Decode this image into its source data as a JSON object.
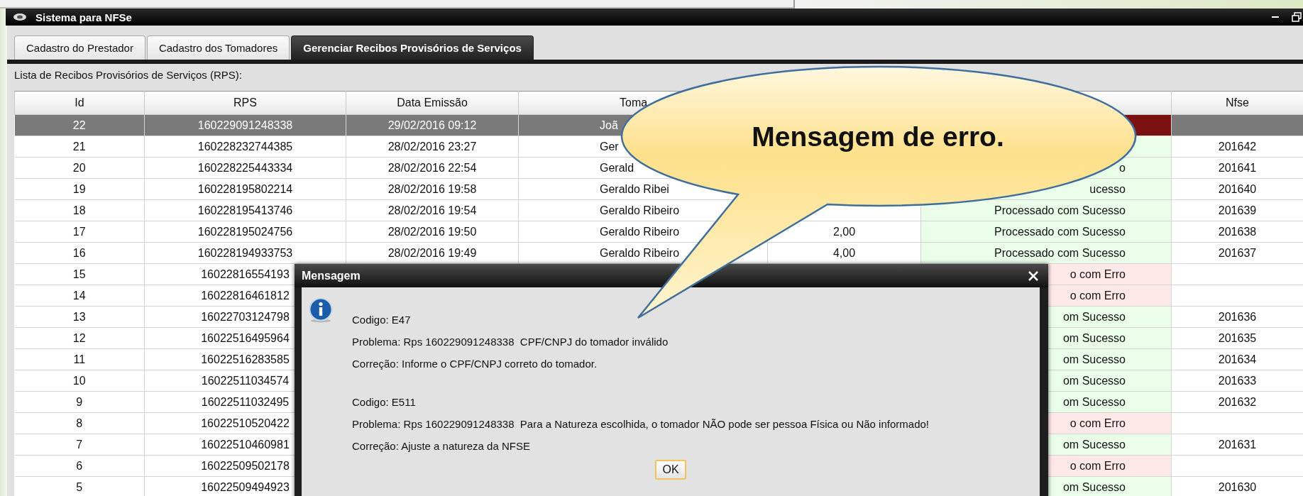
{
  "window": {
    "title": "Sistema para NFSe"
  },
  "tabs": [
    {
      "label": "Cadastro do Prestador",
      "selected": false
    },
    {
      "label": "Cadastro dos Tomadores",
      "selected": false
    },
    {
      "label": "Gerenciar Recibos Provisórios de Serviços",
      "selected": true
    }
  ],
  "list_label": "Lista de Recibos Provisórios de Serviços (RPS):",
  "table": {
    "columns": [
      {
        "label": "Id"
      },
      {
        "label": "RPS"
      },
      {
        "label": "Data Emissão"
      },
      {
        "label": "Toma"
      },
      {},
      {},
      {
        "label": "Nfse"
      }
    ],
    "rows": [
      {
        "id": "22",
        "rps": "160229091248338",
        "date": "29/02/2016 09:12",
        "tomador": "Joã",
        "failed": true,
        "selected": true
      },
      {
        "id": "21",
        "rps": "160228232744385",
        "date": "28/02/2016 23:27",
        "tomador": "Ger",
        "failed": false,
        "nfse": "201642",
        "selected": false
      },
      {
        "id": "20",
        "rps": "160228225443334",
        "date": "28/02/2016 22:54",
        "tomador": "Gerald",
        "status": "o",
        "failed": false,
        "nfse": "201641",
        "selected": false
      },
      {
        "id": "19",
        "rps": "160228195802214",
        "date": "28/02/2016 19:58",
        "tomador": "Geraldo Ribei",
        "status": "ucesso",
        "failed": false,
        "nfse": "201640",
        "selected": false
      },
      {
        "id": "18",
        "rps": "160228195413746",
        "date": "28/02/2016 19:54",
        "tomador": "Geraldo Ribeiro",
        "status": "Processado com Sucesso",
        "failed": false,
        "nfse": "201639",
        "selected": false
      },
      {
        "id": "17",
        "rps": "160228195024756",
        "date": "28/02/2016 19:50",
        "tomador": "Geraldo Ribeiro",
        "valor": "2,00",
        "status": "Processado com Sucesso",
        "failed": false,
        "nfse": "201638",
        "selected": false
      },
      {
        "id": "16",
        "rps": "160228194933753",
        "date": "28/02/2016 19:49",
        "tomador": "Geraldo Ribeiro",
        "valor": "4,00",
        "status": "Processado com Sucesso",
        "failed": false,
        "nfse": "201637",
        "selected": false
      },
      {
        "id": "15",
        "rps": "16022816554193",
        "status": "o com Erro",
        "failed": true,
        "selected": false
      },
      {
        "id": "14",
        "rps": "16022816461812",
        "status": "o com Erro",
        "failed": true,
        "selected": false
      },
      {
        "id": "13",
        "rps": "16022703124798",
        "status": "om Sucesso",
        "failed": false,
        "nfse": "201636",
        "selected": false
      },
      {
        "id": "12",
        "rps": "16022516495964",
        "status": "om Sucesso",
        "failed": false,
        "nfse": "201635",
        "selected": false
      },
      {
        "id": "11",
        "rps": "16022516283585",
        "status": "om Sucesso",
        "failed": false,
        "nfse": "201634",
        "selected": false
      },
      {
        "id": "10",
        "rps": "16022511034574",
        "status": "om Sucesso",
        "failed": false,
        "nfse": "201633",
        "selected": false
      },
      {
        "id": "9",
        "rps": "16022511032495",
        "status": "om Sucesso",
        "failed": false,
        "nfse": "201632",
        "selected": false
      },
      {
        "id": "8",
        "rps": "16022510520422",
        "status": "o com Erro",
        "failed": true,
        "selected": false
      },
      {
        "id": "7",
        "rps": "16022510460981",
        "status": "om Sucesso",
        "failed": false,
        "nfse": "201631",
        "selected": false
      },
      {
        "id": "6",
        "rps": "16022509502178",
        "status": "o com Erro",
        "failed": true,
        "selected": false
      },
      {
        "id": "5",
        "rps": "16022509494923",
        "status": "om Sucesso",
        "failed": false,
        "nfse": "201630",
        "selected": false
      }
    ]
  },
  "dialog": {
    "title": "Mensagem",
    "messages": [
      {
        "lines": [
          "Codigo: E47",
          "Problema: Rps 160229091248338  CPF/CNPJ do tomador inválido",
          "Correção: Informe o CPF/CNPJ correto do tomador."
        ]
      },
      {
        "lines": [
          "Codigo: E511",
          "Problema: Rps 160229091248338  Para a Natureza escolhida, o tomador NÃO pode ser pessoa Física ou Não informado!",
          "Correção: Ajuste a natureza da NFSE"
        ]
      }
    ],
    "button": "OK"
  },
  "callout": {
    "text": "Mensagem de erro."
  }
}
